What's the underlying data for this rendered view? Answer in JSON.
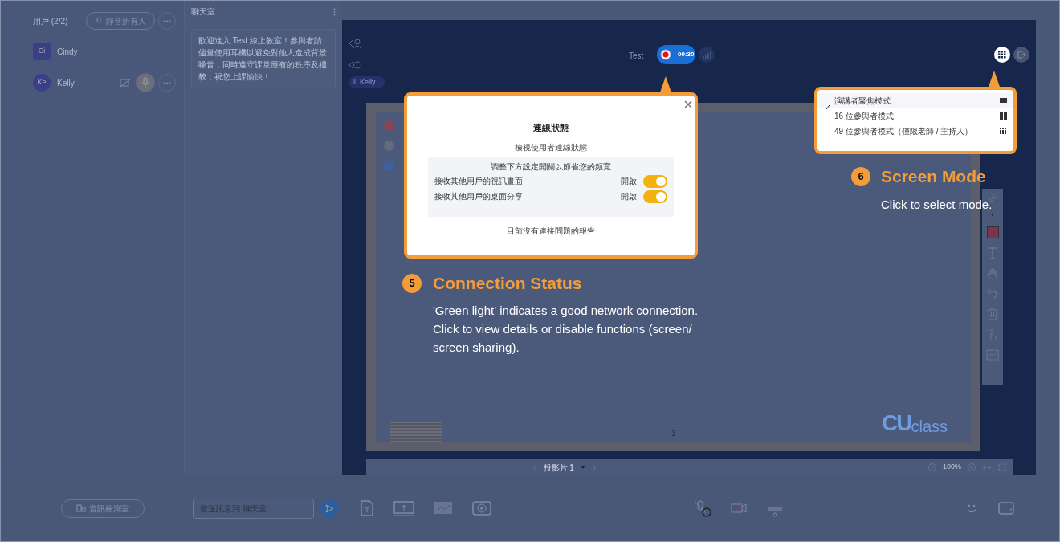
{
  "users_panel": {
    "title": "用戶 (2/2)",
    "mute_all": "靜音所有人",
    "users": [
      {
        "initials": "Ci",
        "name": "Cindy",
        "kind": "host"
      },
      {
        "initials": "Ke",
        "name": "Kelly",
        "kind": "participant"
      }
    ]
  },
  "chat": {
    "title": "聊天室",
    "welcome": "歡迎進入 Test 線上教室！參與者請儘量使用耳機以避免對他人造成背景噪音，同時遵守課堂應有的秩序及禮貌，祝您上課愉快！",
    "placeholder": "發送訊息到 聊天室"
  },
  "audio_check_button": "音訊檢測室",
  "stage": {
    "class_name": "Test",
    "timer": "00:30",
    "speaker": "Kelly",
    "page_number": "1",
    "slide_label": "投影片 1",
    "zoom": "100%",
    "logo": {
      "mark": "CU",
      "text": "class"
    },
    "pen_colors": [
      {
        "color": "#8a4656"
      },
      {
        "color": "#646b7c"
      },
      {
        "color": "#3a62a0"
      }
    ],
    "swatch": {
      "color": "#7a3450"
    }
  },
  "connection_popup": {
    "title": "連線狀態",
    "subtitle": "檢視使用者連線狀態",
    "settings_heading": "調整下方設定開關以節省您的頻寬",
    "settings": [
      {
        "label": "接收其他用戶的視訊畫面",
        "state_label": "開啟",
        "on": true
      },
      {
        "label": "接收其他用戶的桌面分享",
        "state_label": "開啟",
        "on": true
      }
    ],
    "footer": "目前沒有連接問題的報告"
  },
  "screen_mode_menu": {
    "items": [
      {
        "label": "演講者聚焦模式",
        "selected": true,
        "kind": "focus"
      },
      {
        "label": "16 位參與者模式",
        "selected": false,
        "kind": "grid4"
      },
      {
        "label": "49 位參與者模式（僅限老師 / 主持人）",
        "selected": false,
        "kind": "grid9"
      }
    ]
  },
  "callouts": [
    {
      "number": "5",
      "title": "Connection Status",
      "lines": [
        "'Green light' indicates a good network connection.",
        "Click to view details or disable functions (screen/",
        "screen sharing)."
      ]
    },
    {
      "number": "6",
      "title": "Screen Mode",
      "lines": [
        "Click to select mode."
      ]
    }
  ]
}
